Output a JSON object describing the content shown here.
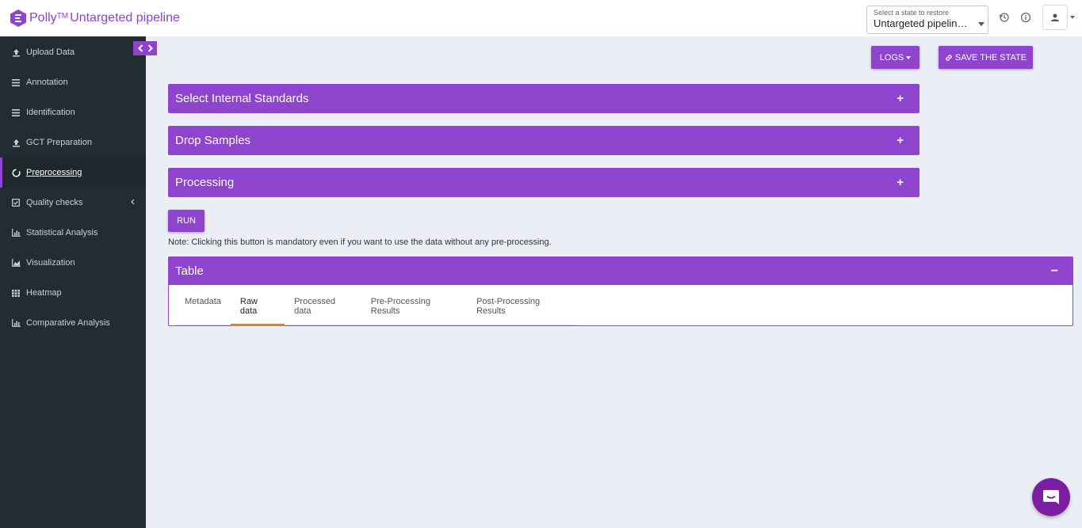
{
  "brand": {
    "name": "Polly",
    "tm": "TM",
    "title": "Untargeted pipeline"
  },
  "state_select": {
    "label": "Select a state to restore",
    "value": "Untargeted pipeline ..."
  },
  "sidebar": {
    "items": [
      {
        "label": "Upload Data",
        "icon": "upload-icon"
      },
      {
        "label": "Annotation",
        "icon": "bars-icon"
      },
      {
        "label": "Identification",
        "icon": "bars-icon"
      },
      {
        "label": "GCT Preparation",
        "icon": "upload-icon"
      },
      {
        "label": "Preprocessing",
        "icon": "circle-notch-icon",
        "active": true
      },
      {
        "label": "Quality checks",
        "icon": "check-square-icon",
        "has_children": true
      },
      {
        "label": "Statistical Analysis",
        "icon": "bar-chart-icon"
      },
      {
        "label": "Visualization",
        "icon": "area-chart-icon"
      },
      {
        "label": "Heatmap",
        "icon": "grid-icon"
      },
      {
        "label": "Comparative Analysis",
        "icon": "bar-chart-icon"
      }
    ]
  },
  "toolbar": {
    "logs_label": "LOGS",
    "save_state_label": "SAVE THE STATE"
  },
  "panels": [
    {
      "title": "Select Internal Standards",
      "toggle": "+"
    },
    {
      "title": "Drop Samples",
      "toggle": "+"
    },
    {
      "title": "Processing",
      "toggle": "+"
    }
  ],
  "run": {
    "label": "RUN",
    "note": "Note: Clicking this button is mandatory even if you want to use the data without any pre-processing."
  },
  "table": {
    "title": "Table",
    "toggle": "−",
    "tabs": [
      "Metadata",
      "Raw data",
      "Processed data",
      "Pre-Processing Results",
      "Post-Processing Results"
    ],
    "active_tab": "Raw data"
  },
  "colors": {
    "accent": "#8e44cc",
    "sidebar_bg": "#222d32",
    "tab_indicator": "#e67e22",
    "page_bg": "#eceef6"
  }
}
